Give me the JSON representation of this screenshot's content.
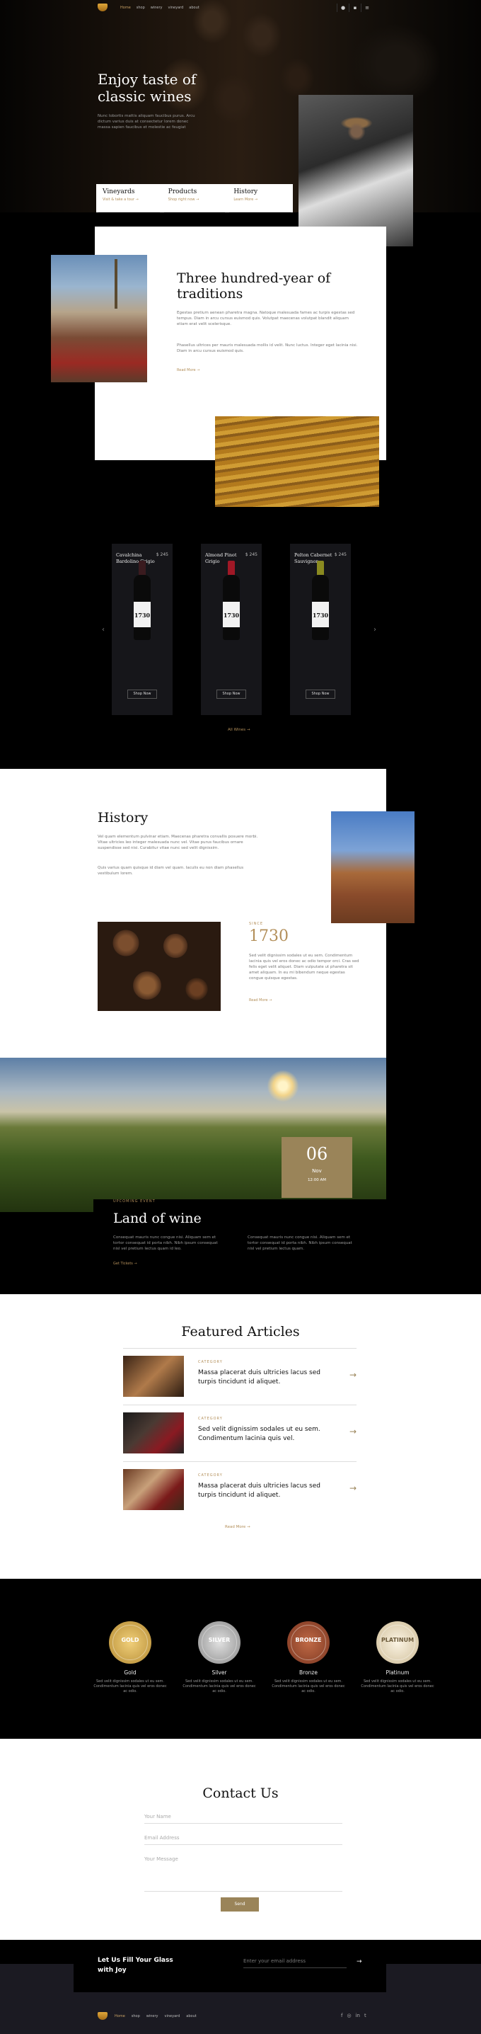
{
  "nav": {
    "links": [
      "Home",
      "shop",
      "winery",
      "vineyard",
      "about"
    ],
    "icons": [
      "search-icon",
      "cart-icon",
      "menu-icon"
    ]
  },
  "hero": {
    "title_line1": "Enjoy taste of",
    "title_line2": "classic wines",
    "text": "Nunc lobortis mattis aliquam faucibus purus. Arcu dictum varius duis at consectetur lorem donec massa sapien faucibus et molestie ac feugiat",
    "cards": [
      {
        "title": "Vineyards",
        "link": "Visit & take a tour"
      },
      {
        "title": "Products",
        "link": "Shop right now"
      },
      {
        "title": "History",
        "link": "Learn More"
      }
    ]
  },
  "about": {
    "title_line1": "Three hundred-year  of",
    "title_line2": "traditions",
    "p1": "Egestas pretium aenean pharetra magna. Natoque malesuada fames ac turpis egestas sed tempus. Diam in arcu cursus euismod quis. Volutpat maecenas volutpat blandit aliquam etiam erat velit scelerisque.",
    "p2": "Phasellus ultrices per mauris malesuada mollis id velit. Nunc luctus. Integer eget lacinia nisi. Diam in arcu cursus euismod quis.",
    "more": "Read More"
  },
  "products": {
    "items": [
      {
        "name": "Cavalchina Bardolino Grigio",
        "price": "$ 245",
        "year": "1730",
        "cta": "Shop Now"
      },
      {
        "name": "Almond Pinot Grigio",
        "price": "$ 245",
        "year": "1730",
        "cta": "Shop Now"
      },
      {
        "name": "Pelton Cabernet Sauvignon",
        "price": "$ 245",
        "year": "1730",
        "cta": "Shop Now"
      }
    ],
    "all": "All Wines"
  },
  "history": {
    "title": "History",
    "p1": "Vel quam elementum pulvinar etiam. Maecenas pharetra convallis posuere morbi. Vitae ultricies leo integer malesuada nunc vel. Vitae purus faucibus ornare suspendisse sed nisi. Curabitur vitae nunc sed velit dignissim.",
    "p2": "Quis varius quam quisque id diam vel quam. Iaculis eu non diam phasellus vestibulum lorem.",
    "since_label": "SINCE",
    "year": "1730",
    "p3": "Sed velit dignissim sodales ut eu sem. Condimentum lacinia quis vel eros donec ac odio tempor orci. Cras sed felis eget velit aliquet. Diam vulputate ut pharetra sit amet aliquam. In eu mi bibendum neque egestas congue quisque egestas.",
    "more": "Read More"
  },
  "event": {
    "day": "06",
    "month": "Nov",
    "time": "12:00 AM",
    "label": "UPCOMING EVENT",
    "title": "Land of wine",
    "p1": "Consequat mauris nunc congue nisi. Aliquam sem et tortor consequat id porta nibh. Nibh ipsum consequat nisl vel pretium lectus quam id leo.",
    "p2": "Consequat mauris nunc congue nisi. Aliquam sem et tortor consequat id porta nibh. Nibh ipsum consequat nisl vel pretium lectus quam.",
    "more": "Get Tickets"
  },
  "articles": {
    "title": "Featured Articles",
    "items": [
      {
        "category": "CATEGORY",
        "title": "Massa placerat duis ultricies lacus sed turpis tincidunt id aliquet."
      },
      {
        "category": "CATEGORY",
        "title": "Sed velit dignissim sodales ut eu sem. Condimentum lacinia quis vel."
      },
      {
        "category": "CATEGORY",
        "title": "Massa placerat duis ultricies lacus sed turpis tincidunt id aliquet."
      }
    ],
    "more": "Read More"
  },
  "awards": {
    "items": [
      {
        "medal": "GOLD",
        "name": "Gold",
        "desc": "Sed velit dignissim sodales ut eu sem. Condimentum lacinia quis vel eros donec ac odio.",
        "color": "#c9a24a"
      },
      {
        "medal": "SILVER",
        "name": "Silver",
        "desc": "Sed velit dignissim sodales ut eu sem. Condimentum lacinia quis vel eros donec ac odio.",
        "color": "#a7a7a7"
      },
      {
        "medal": "BRONZE",
        "name": "Bronze",
        "desc": "Sed velit dignissim sodales ut eu sem. Condimentum lacinia quis vel eros donec ac odio.",
        "color": "#9a4f33"
      },
      {
        "medal": "PLATINUM",
        "name": "Platinum",
        "desc": "Sed velit dignissim sodales ut eu sem. Condimentum lacinia quis vel eros donec ac odio.",
        "color": "#e3d6bd"
      }
    ]
  },
  "contact": {
    "title": "Contact Us",
    "name_placeholder": "Your Name",
    "email_placeholder": "Email Address",
    "message_placeholder": "Your Message",
    "send": "Send"
  },
  "newsletter": {
    "title_line1": "Let Us Fill Your Glass",
    "title_line2": "with Joy",
    "placeholder": "Enter your email address"
  },
  "footer": {
    "links": [
      "Home",
      "shop",
      "winery",
      "vineyard",
      "about"
    ],
    "social": [
      "facebook-icon",
      "instagram-icon",
      "linkedin-icon",
      "twitter-icon"
    ]
  },
  "colors": {
    "accent": "#9a8459",
    "accent_text": "#b38f5a"
  }
}
